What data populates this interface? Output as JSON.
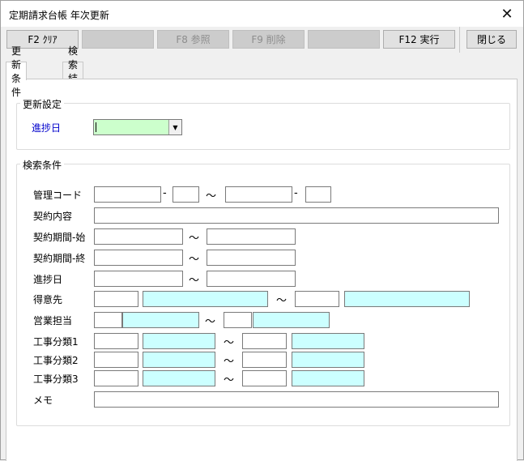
{
  "window": {
    "title": "定期請求台帳 年次更新",
    "close_glyph": "✕"
  },
  "toolbar": {
    "f2": "F2 ｸﾘｱ",
    "blank1": "",
    "f8": "F8 参照",
    "f9": "F9 削除",
    "blank2": "",
    "f12": "F12 実行",
    "close": "閉じる"
  },
  "tabs": [
    {
      "label": "更新条件",
      "active": true
    },
    {
      "label": "検索結果",
      "active": false
    }
  ],
  "update_settings": {
    "legend": "更新設定",
    "progress_date_label": "進捗日",
    "progress_date_value": "",
    "dropdown_glyph": "▼"
  },
  "search": {
    "legend": "検索条件",
    "separator_dash": "-",
    "separator_tilde": "～",
    "labels": {
      "management_code": "管理コード",
      "contract_content": "契約内容",
      "contract_start": "契約期間-始",
      "contract_end": "契約期間-終",
      "progress_date": "進捗日",
      "customer": "得意先",
      "sales_rep": "営業担当",
      "work_cat1": "工事分類1",
      "work_cat2": "工事分類2",
      "work_cat3": "工事分類3",
      "memo": "メモ"
    }
  },
  "colors": {
    "required_field": "#ccffcc",
    "lookup_field": "#ccffff",
    "label_blue": "#0000cc"
  }
}
